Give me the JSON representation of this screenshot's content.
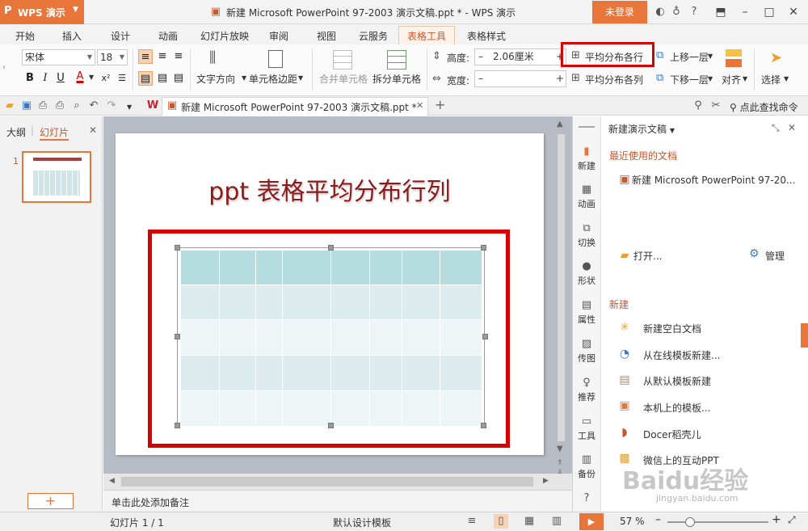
{
  "app": {
    "logo": "P",
    "name": "WPS 演示",
    "title": "新建 Microsoft PowerPoint 97-2003 演示文稿.ppt * - WPS 演示",
    "login_label": "未登录"
  },
  "menu": [
    "开始",
    "插入",
    "设计",
    "动画",
    "幻灯片放映",
    "审阅",
    "视图",
    "云服务",
    "表格工具",
    "表格样式"
  ],
  "ribbon": {
    "font_name": "宋体",
    "font_size": "18",
    "bold": "B",
    "italic": "I",
    "underline": "U",
    "font_color": "A",
    "text_direction": "文字方向",
    "cell_margin": "单元格边距",
    "merge_cells": "合并单元格",
    "split_cells": "拆分单元格",
    "height_label": "高度:",
    "height_value": "2.06厘米",
    "width_label": "宽度:",
    "width_value": "",
    "distribute_rows": "平均分布各行",
    "distribute_cols": "平均分布各列",
    "bring_forward": "上移一层",
    "send_backward": "下移一层",
    "align": "对齐",
    "select": "选择"
  },
  "quickbar": {
    "doc_tab": "新建 Microsoft PowerPoint 97-2003 演示文稿.ppt *",
    "search_placeholder": "点此查找命令"
  },
  "left_panel": {
    "tab_outline": "大纲",
    "tab_slides": "幻灯片",
    "slide_number": "1",
    "add_button": "+"
  },
  "slide": {
    "title": "ppt 表格平均分布行列",
    "rows": 5,
    "cols": 8
  },
  "notes_placeholder": "单击此处添加备注",
  "right_strip": [
    "新建",
    "动画",
    "切换",
    "形状",
    "属性",
    "传图",
    "推荐",
    "工具",
    "备份"
  ],
  "task_pane": {
    "header": "新建演示文稿",
    "recent_title": "最近使用的文档",
    "recent_file": "新建 Microsoft PowerPoint 97-20...",
    "open": "打开...",
    "manage": "管理",
    "new_title": "新建",
    "new_items": [
      "新建空白文档",
      "从在线模板新建...",
      "从默认模板新建",
      "本机上的模板...",
      "Docer稻壳儿",
      "微信上的互动PPT"
    ]
  },
  "status": {
    "slide_info": "幻灯片 1 / 1",
    "template": "默认设计模板",
    "zoom": "57 %"
  },
  "watermark": {
    "text": "Baidu经验",
    "url": "jingyan.baidu.com"
  },
  "colors": {
    "accent": "#e8753a",
    "highlight": "#d40000",
    "title_red": "#8b1a1a",
    "table_header": "#b5dde0",
    "table_row": "#dcecee"
  }
}
